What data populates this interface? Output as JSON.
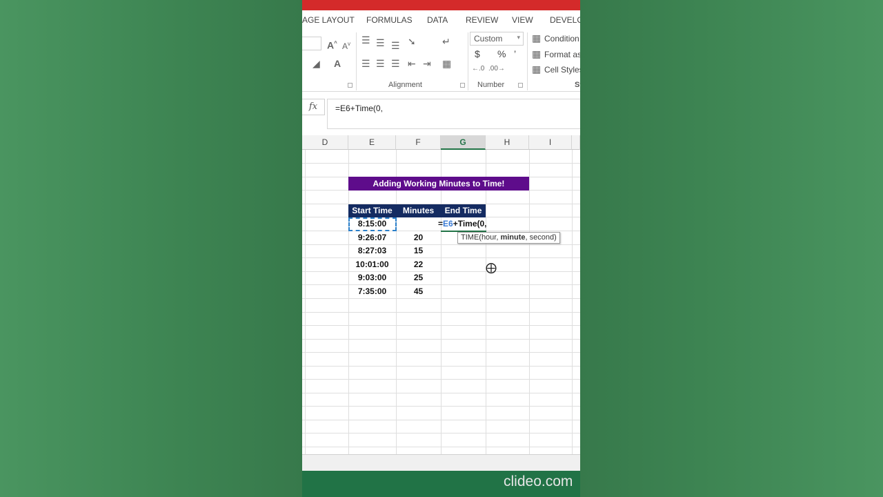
{
  "menu": [
    "AGE LAYOUT",
    "FORMULAS",
    "DATA",
    "REVIEW",
    "VIEW",
    "DEVELO"
  ],
  "ribbon": {
    "number_format": "Custom",
    "currency_symbol": "$",
    "percent_symbol": "%",
    "comma_symbol": "’",
    "conditional": "Condition",
    "format_as": "Format as",
    "cell_styles": "Cell Styles",
    "alignment_label": "Alignment",
    "number_label": "Number",
    "styles_label_partial": "St"
  },
  "formula_bar": {
    "fx_label": "fx",
    "formula": "=E6+Time(0,"
  },
  "columns": [
    "D",
    "E",
    "F",
    "G",
    "H",
    "I"
  ],
  "active_column": "G",
  "sheet": {
    "title": "Adding Working Minutes to Time!",
    "headers": [
      "Start Time",
      "Minutes",
      "End Time"
    ],
    "rows": [
      {
        "start": "8:15:00",
        "minutes": ""
      },
      {
        "start": "9:26:07",
        "minutes": "20"
      },
      {
        "start": "8:27:03",
        "minutes": "15"
      },
      {
        "start": "10:01:00",
        "minutes": "22"
      },
      {
        "start": "9:03:00",
        "minutes": "25"
      },
      {
        "start": "7:35:00",
        "minutes": "45"
      }
    ],
    "editing": {
      "prefix": "=",
      "ref": "E6",
      "rest": "+Time(0,"
    },
    "tooltip": {
      "fn": "TIME(hour, ",
      "bold": "minute",
      "tail": ", second)"
    }
  },
  "watermark": "clideo.com",
  "colors": {
    "title_bg": "#5e0c8b",
    "header_bg": "#142b61",
    "excel_green": "#217346",
    "background_green": "#3f8a55"
  }
}
